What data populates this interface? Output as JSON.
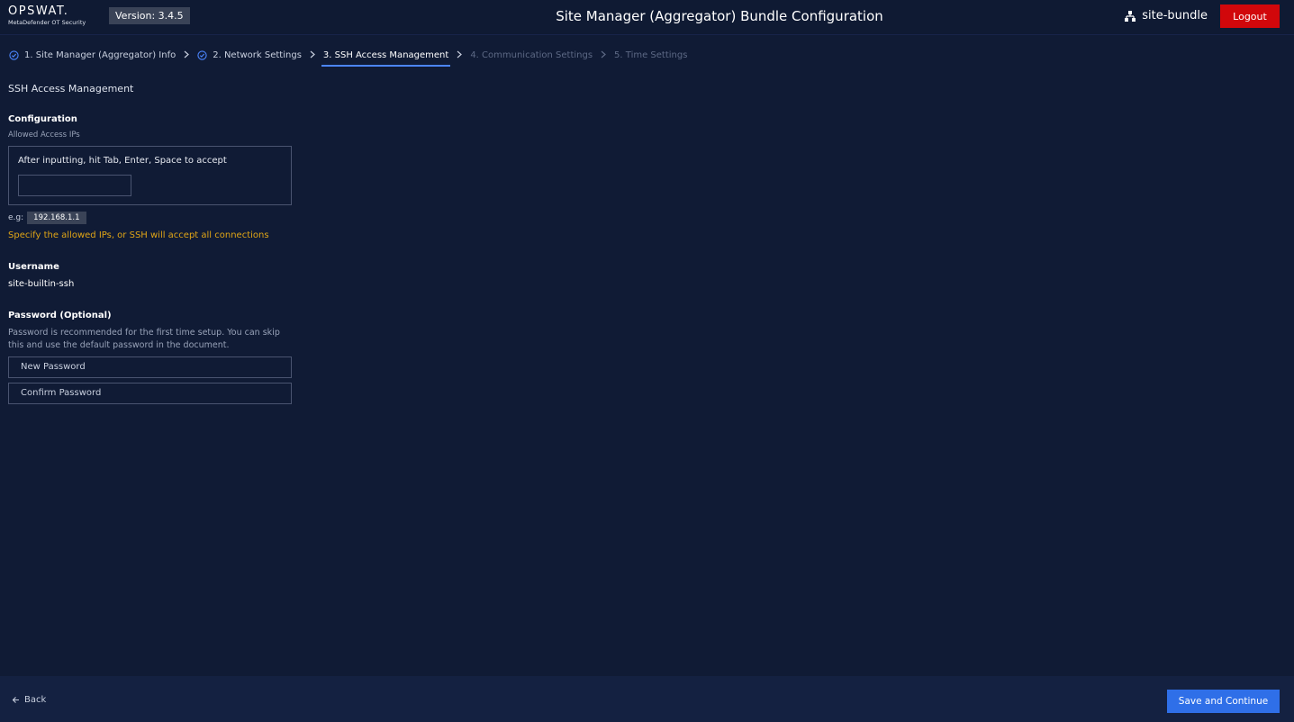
{
  "header": {
    "logo_main": "OPSWAT.",
    "logo_sub": "MetaDefender OT Security",
    "version": "Version: 3.4.5",
    "title": "Site Manager (Aggregator) Bundle Configuration",
    "bundle_icon": "sitemap-icon",
    "bundle_name": "site-bundle",
    "logout_label": "Logout"
  },
  "stepper": {
    "steps": [
      {
        "label": "1. Site Manager (Aggregator) Info",
        "state": "done"
      },
      {
        "label": "2. Network Settings",
        "state": "done"
      },
      {
        "label": "3. SSH Access Management",
        "state": "active"
      },
      {
        "label": "4. Communication Settings",
        "state": "todo"
      },
      {
        "label": "5. Time Settings",
        "state": "todo"
      }
    ]
  },
  "main": {
    "section_title": "SSH Access Management",
    "configuration_label": "Configuration",
    "allowed_ips_label": "Allowed Access IPs",
    "ip_box_hint": "After inputting, hit Tab, Enter, Space to accept",
    "ip_input_value": "",
    "example_label": "e.g:",
    "example_value": "192.168.1.1",
    "warning": "Specify the allowed IPs, or SSH will accept all connections",
    "username_label": "Username",
    "username_value": "site-builtin-ssh",
    "password_label": "Password (Optional)",
    "password_hint": "Password is recommended for the first time setup. You can skip this and use the default password in the document.",
    "new_password_placeholder": "New Password",
    "confirm_password_placeholder": "Confirm Password"
  },
  "footer": {
    "back_label": "Back",
    "save_label": "Save and Continue"
  },
  "colors": {
    "background": "#101b35",
    "accent": "#2f6fe8",
    "logout": "#d1070b",
    "warning": "#e0a516"
  }
}
